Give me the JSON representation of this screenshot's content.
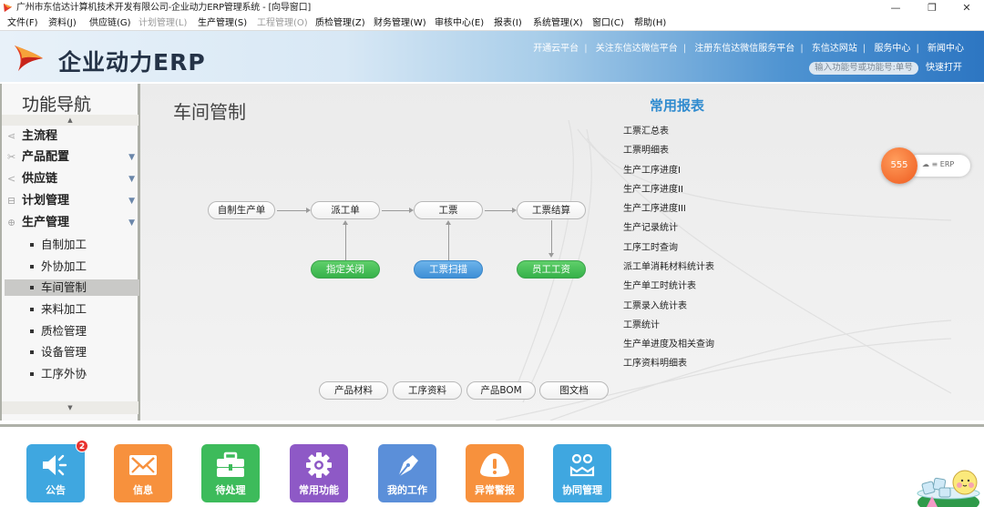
{
  "window": {
    "title": "广州市东信达计算机技术开发有限公司-企业动力ERP管理系统 - [向导窗口]",
    "controls": {
      "minimize": "—",
      "restore": "❐",
      "close": "✕"
    }
  },
  "menubar": [
    {
      "label": "文件(F)",
      "enabled": true
    },
    {
      "label": "资料(J)",
      "enabled": true
    },
    {
      "label": "供应链(G)",
      "enabled": true
    },
    {
      "label": "计划管理(L)",
      "enabled": false
    },
    {
      "label": "生产管理(S)",
      "enabled": true
    },
    {
      "label": "工程管理(O)",
      "enabled": false
    },
    {
      "label": "质检管理(Z)",
      "enabled": true
    },
    {
      "label": "财务管理(W)",
      "enabled": true
    },
    {
      "label": "审核中心(E)",
      "enabled": true
    },
    {
      "label": "报表(I)",
      "enabled": true
    },
    {
      "label": "系统管理(X)",
      "enabled": true
    },
    {
      "label": "窗口(C)",
      "enabled": true
    },
    {
      "label": "帮助(H)",
      "enabled": true
    }
  ],
  "header": {
    "brand": "企业动力ERP",
    "links": [
      "开通云平台",
      "关注东信达微信平台",
      "注册东信达微信服务平台",
      "东信达网站",
      "服务中心",
      "新闻中心"
    ],
    "quick_input_placeholder": "输入功能号或功能号:单号",
    "quick_open": "快速打开"
  },
  "sidebar": {
    "title": "功能导航",
    "up_arrow": "▲",
    "down_arrow": "▼",
    "groups": [
      {
        "label": "主流程",
        "icon": "share-icon",
        "glyph": "⋖",
        "expandable": false
      },
      {
        "label": "产品配置",
        "icon": "tools-icon",
        "glyph": "✂",
        "expandable": true
      },
      {
        "label": "供应链",
        "icon": "link-icon",
        "glyph": "<",
        "expandable": true
      },
      {
        "label": "计划管理",
        "icon": "calendar-icon",
        "glyph": "⊟",
        "expandable": true
      },
      {
        "label": "生产管理",
        "icon": "globe-icon",
        "glyph": "⊕",
        "expandable": true
      }
    ],
    "expand_glyph": "▼",
    "sub_items": [
      "自制加工",
      "外协加工",
      "车间管制",
      "来料加工",
      "质检管理",
      "设备管理",
      "工序外协"
    ],
    "active_sub": "车间管制"
  },
  "main": {
    "title": "车间管制",
    "flow": {
      "top_row": [
        "自制生产单",
        "派工单",
        "工票",
        "工票结算"
      ],
      "bottom_row": [
        {
          "label": "指定关闭",
          "color": "green"
        },
        {
          "label": "工票扫描",
          "color": "blue"
        },
        {
          "label": "员工工资",
          "color": "green"
        }
      ]
    },
    "resource_buttons": [
      "产品材料",
      "工序资料",
      "产品BOM",
      "图文档"
    ],
    "reports": {
      "title": "常用报表",
      "items": [
        "工票汇总表",
        "工票明细表",
        "生产工序进度I",
        "生产工序进度II",
        "生产工序进度III",
        "生产记录统计",
        "工序工时查询",
        "派工单消耗材料统计表",
        "生产单工时统计表",
        "工票录入统计表",
        "工票统计",
        "生产单进度及相关查询",
        "工序资料明细表"
      ]
    }
  },
  "float_widget": {
    "count": "555",
    "label": "ERP"
  },
  "bottom_tiles": [
    {
      "label": "公告",
      "icon": "megaphone-icon",
      "color": "#3fa7e0",
      "badge": "2"
    },
    {
      "label": "信息",
      "icon": "mail-icon",
      "color": "#f7913d",
      "badge": null
    },
    {
      "label": "待处理",
      "icon": "briefcase-icon",
      "color": "#3dbb5b",
      "badge": null
    },
    {
      "label": "常用功能",
      "icon": "gear-icon",
      "color": "#8e59c6",
      "badge": null
    },
    {
      "label": "我的工作",
      "icon": "pen-icon",
      "color": "#5b8fd9",
      "badge": null
    },
    {
      "label": "异常警报",
      "icon": "alert-icon",
      "color": "#f7913d",
      "badge": null
    },
    {
      "label": "协同管理",
      "icon": "collaboration-icon",
      "color": "#3fa7e0",
      "badge": null
    }
  ]
}
